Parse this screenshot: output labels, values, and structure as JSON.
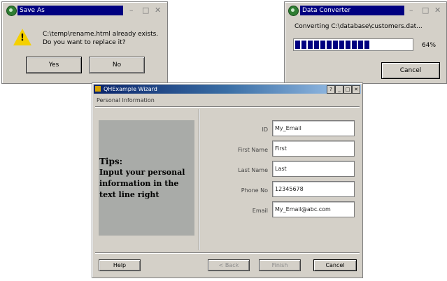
{
  "save_dialog": {
    "title": "Save As",
    "message_line1": "C:\\temp\\rename.html already exists.",
    "message_line2": "Do you want to replace it?",
    "yes_label": "Yes",
    "no_label": "No",
    "icon": "warning-icon"
  },
  "converter_dialog": {
    "title": "Data Converter",
    "status_text": "Converting C:\\database\\customers.dat...",
    "progress_percent_label": "64%",
    "progress": 0.64,
    "cancel_label": "Cancel"
  },
  "wizard": {
    "title": "QHExample Wizard",
    "page_heading": "Personal Information",
    "tips_title": "Tips:",
    "tips_text": "Input your personal information in the text line right",
    "fields": [
      {
        "label": "ID",
        "value": "My_Email"
      },
      {
        "label": "First Name",
        "value": "First"
      },
      {
        "label": "Last Name",
        "value": "Last"
      },
      {
        "label": "Phone No",
        "value": "12345678"
      },
      {
        "label": "Email",
        "value": "My_Email@abc.com"
      }
    ],
    "help_label": "Help",
    "back_label": "< Back",
    "finish_label": "Finish",
    "cancel_label": "Cancel"
  },
  "colors": {
    "titlebar": "#000080",
    "panel": "#d4d0c8",
    "tips_panel": "#a9aba8",
    "progress": "#000080"
  }
}
